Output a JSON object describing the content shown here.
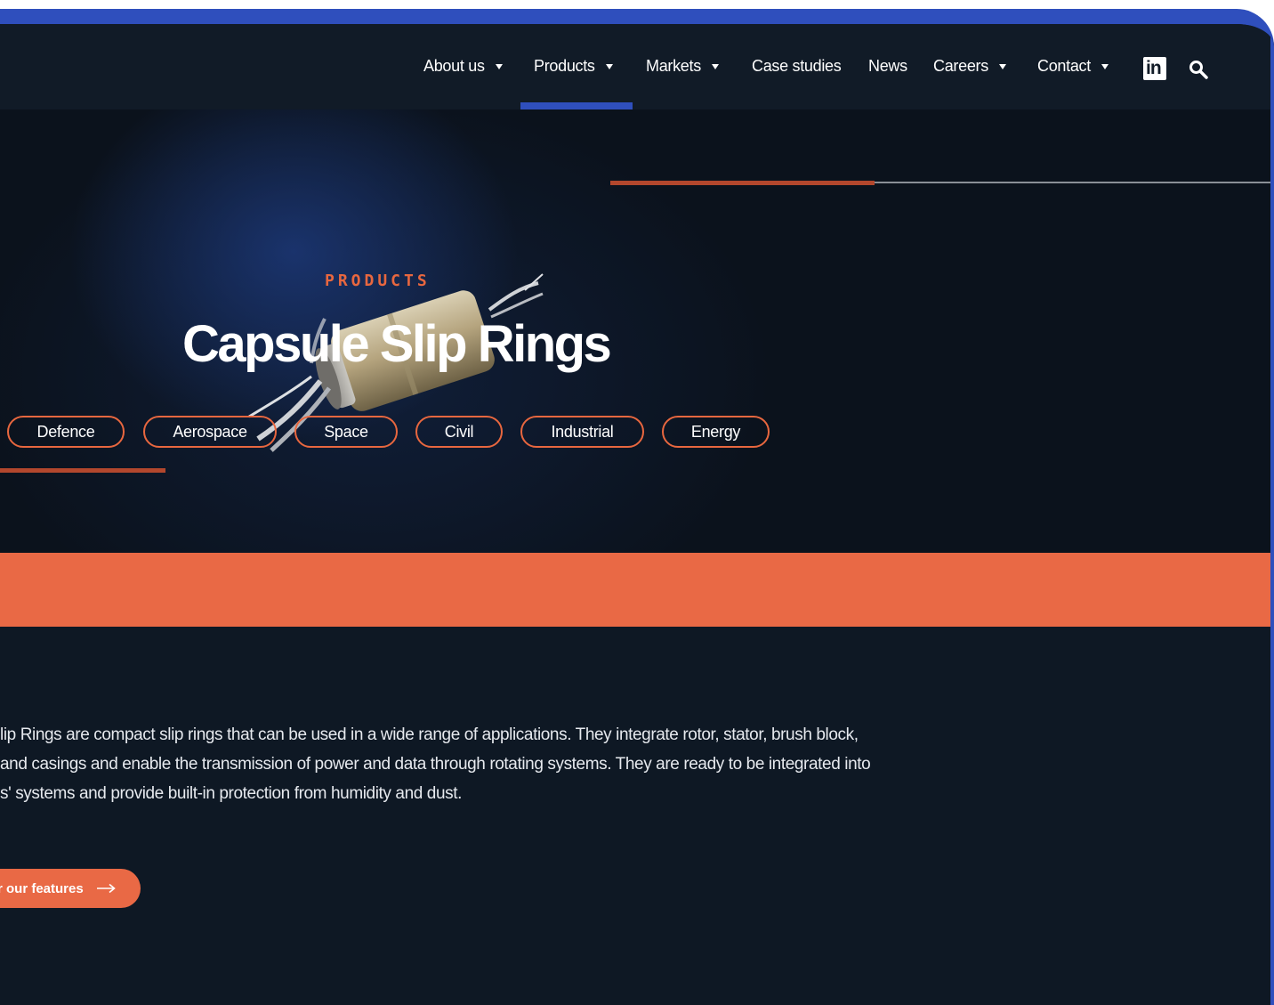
{
  "nav": {
    "items": [
      {
        "label": "About us",
        "dropdown": true
      },
      {
        "label": "Products",
        "dropdown": true,
        "active": true
      },
      {
        "label": "Markets",
        "dropdown": true
      },
      {
        "label": "Case studies",
        "dropdown": false
      },
      {
        "label": "News",
        "dropdown": false
      },
      {
        "label": "Careers",
        "dropdown": true
      },
      {
        "label": "Contact",
        "dropdown": true
      }
    ],
    "linkedin_label": "in",
    "icons": [
      "linkedin-icon",
      "search-icon"
    ]
  },
  "hero": {
    "eyebrow": "PRODUCTS",
    "title": "Capsule Slip Rings",
    "tags": [
      "Defence",
      "Aerospace",
      "Space",
      "Civil",
      "Industrial",
      "Energy"
    ]
  },
  "body": {
    "lines": [
      "lip Rings are compact slip rings that can be used in a wide range of applications. They integrate rotor, stator, brush block,",
      "and casings and enable the transmission of power and data through rotating systems. They are ready to be integrated into",
      "s' systems and provide built-in protection from humidity and dust."
    ],
    "cta_label": "r our features"
  },
  "colors": {
    "accent": "#e96945",
    "brand_blue": "#2f4fbd",
    "background": "#0e1824"
  }
}
